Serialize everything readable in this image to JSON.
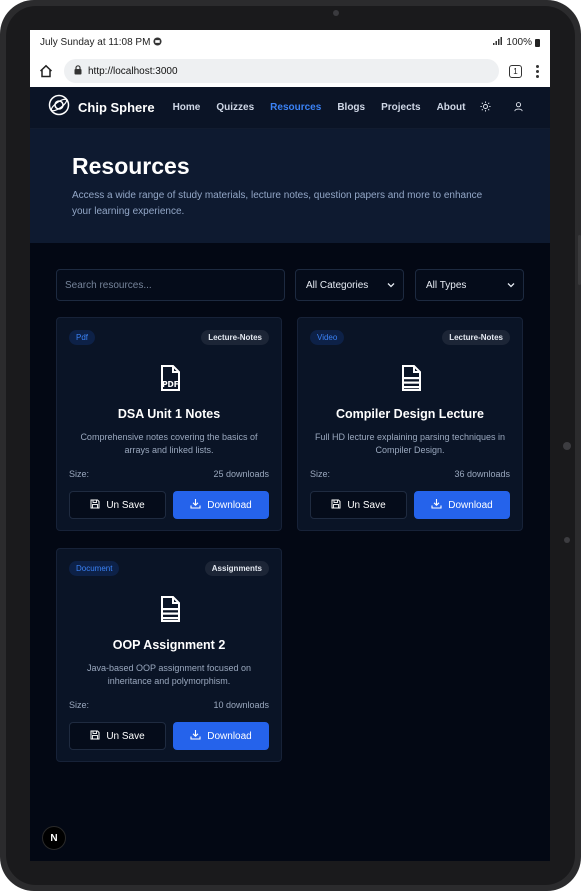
{
  "status_bar": {
    "time_text": "July Sunday at 11:08 PM",
    "battery": "100%"
  },
  "browser": {
    "url": "http://localhost:3000",
    "tab_count": "1"
  },
  "site": {
    "brand": "Chip Sphere",
    "nav": [
      "Home",
      "Quizzes",
      "Resources",
      "Blogs",
      "Projects",
      "About"
    ],
    "active_nav": "Resources"
  },
  "hero": {
    "title": "Resources",
    "subtitle": "Access a wide range of study materials, lecture notes, question papers and more to enhance your learning experience."
  },
  "filters": {
    "search_placeholder": "Search resources...",
    "category": "All Categories",
    "type": "All Types"
  },
  "resources": [
    {
      "type": "Pdf",
      "category": "Lecture-Notes",
      "icon": "pdf-file-icon",
      "title": "DSA Unit 1 Notes",
      "description": "Comprehensive notes covering the basics of arrays and linked lists.",
      "size_label": "Size:",
      "downloads": "25 downloads",
      "save_label": "Un Save",
      "download_label": "Download"
    },
    {
      "type": "Video",
      "category": "Lecture-Notes",
      "icon": "document-icon",
      "title": "Compiler Design Lecture",
      "description": "Full HD lecture explaining parsing techniques in Compiler Design.",
      "size_label": "Size:",
      "downloads": "36 downloads",
      "save_label": "Un Save",
      "download_label": "Download"
    },
    {
      "type": "Document",
      "category": "Assignments",
      "icon": "document-icon",
      "title": "OOP Assignment 2",
      "description": "Java-based OOP assignment focused on inheritance and polymorphism.",
      "size_label": "Size:",
      "downloads": "10 downloads",
      "save_label": "Un Save",
      "download_label": "Download"
    }
  ],
  "dev_badge": "N",
  "colors": {
    "accent": "#2563eb",
    "link_active": "#3b82f6",
    "background": "#030814"
  }
}
